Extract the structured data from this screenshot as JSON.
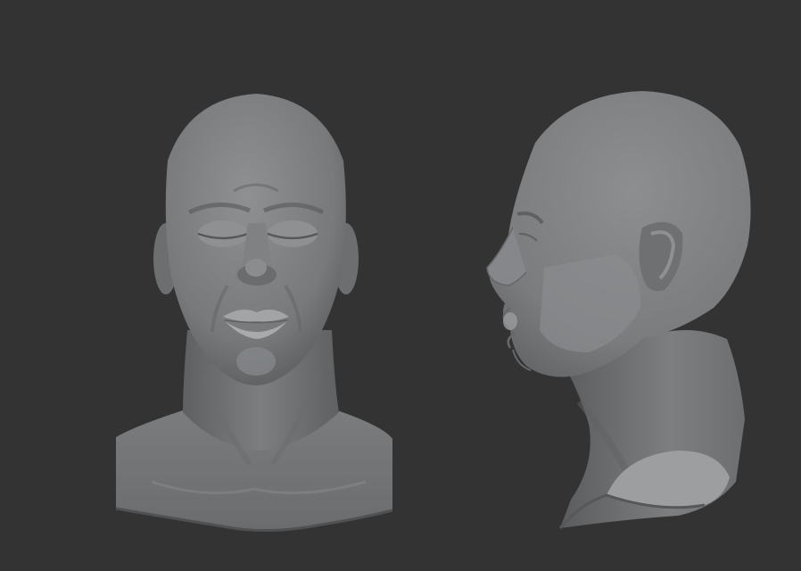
{
  "scene": {
    "background_color": "#333333",
    "sculpt_colors": {
      "base": "#7c7e80",
      "highlight": "#a6a8aa",
      "shadow": "#4a4c4e",
      "cut_surface": "#9c9ea0"
    },
    "models": [
      {
        "view": "front",
        "features": [
          "closed-eyes",
          "nose",
          "lips",
          "ears",
          "neck",
          "shoulders"
        ]
      },
      {
        "view": "side",
        "features": [
          "ear",
          "nose",
          "lips",
          "neck",
          "cut-section"
        ]
      }
    ]
  }
}
